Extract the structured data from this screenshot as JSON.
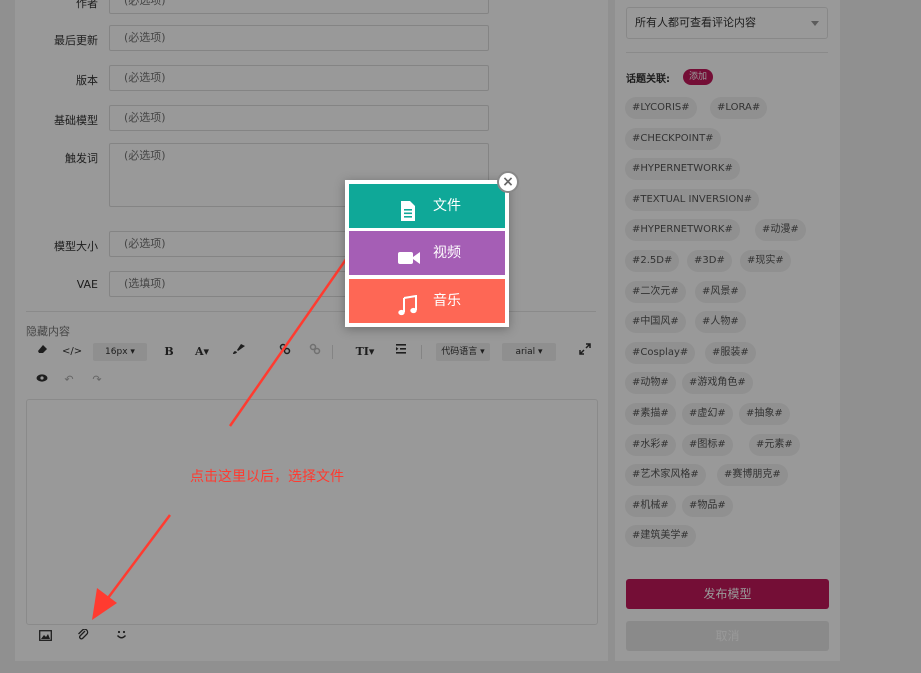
{
  "form": {
    "author": {
      "label": "作者",
      "placeholder": "(必选项)"
    },
    "last_update": {
      "label": "最后更新",
      "placeholder": "(必选项)"
    },
    "version": {
      "label": "版本",
      "placeholder": "(必选项)"
    },
    "base_model": {
      "label": "基础模型",
      "placeholder": "(必选项)"
    },
    "trigger_words": {
      "label": "触发词",
      "placeholder": "(必选项)"
    },
    "model_size": {
      "label": "模型大小",
      "placeholder": "(必选项)"
    },
    "vae": {
      "label": "VAE",
      "placeholder": "(选填项)"
    }
  },
  "hidden_content": {
    "title": "隐藏内容",
    "toolbar": {
      "font_size": "16px",
      "bold": "B",
      "font_color": "A",
      "text_type": "TI",
      "code_lang": "代码语言",
      "font_family": "arial"
    }
  },
  "sidebar": {
    "permission": "所有人都可查看评论内容",
    "topic_label": "话题关联:",
    "topic_add": "添加",
    "tags": [
      "#LYCORIS#",
      "#LORA#",
      "#CHECKPOINT#",
      "#HYPERNETWORK#",
      "#TEXTUAL INVERSION#",
      "#HYPERNETWORK#",
      "#动漫#",
      "#2.5D#",
      "#3D#",
      "#现实#",
      "#二次元#",
      "#风景#",
      "#中国风#",
      "#人物#",
      "#Cosplay#",
      "#服装#",
      "#动物#",
      "#游戏角色#",
      "#素描#",
      "#虚幻#",
      "#抽象#",
      "#水彩#",
      "#图标#",
      "#元素#",
      "#艺术家风格#",
      "#赛博朋克#",
      "#机械#",
      "#物品#",
      "#建筑美学#"
    ],
    "publish": "发布模型",
    "cancel": "取消"
  },
  "popup": {
    "file": "文件",
    "video": "视频",
    "music": "音乐",
    "close": "×"
  },
  "annotation": "点击这里以后，选择文件",
  "colors": {
    "accent": "#c2185b",
    "file": "#0fa898",
    "video": "#a55eb5",
    "music": "#fe6755",
    "arrow": "#ff3b30"
  }
}
